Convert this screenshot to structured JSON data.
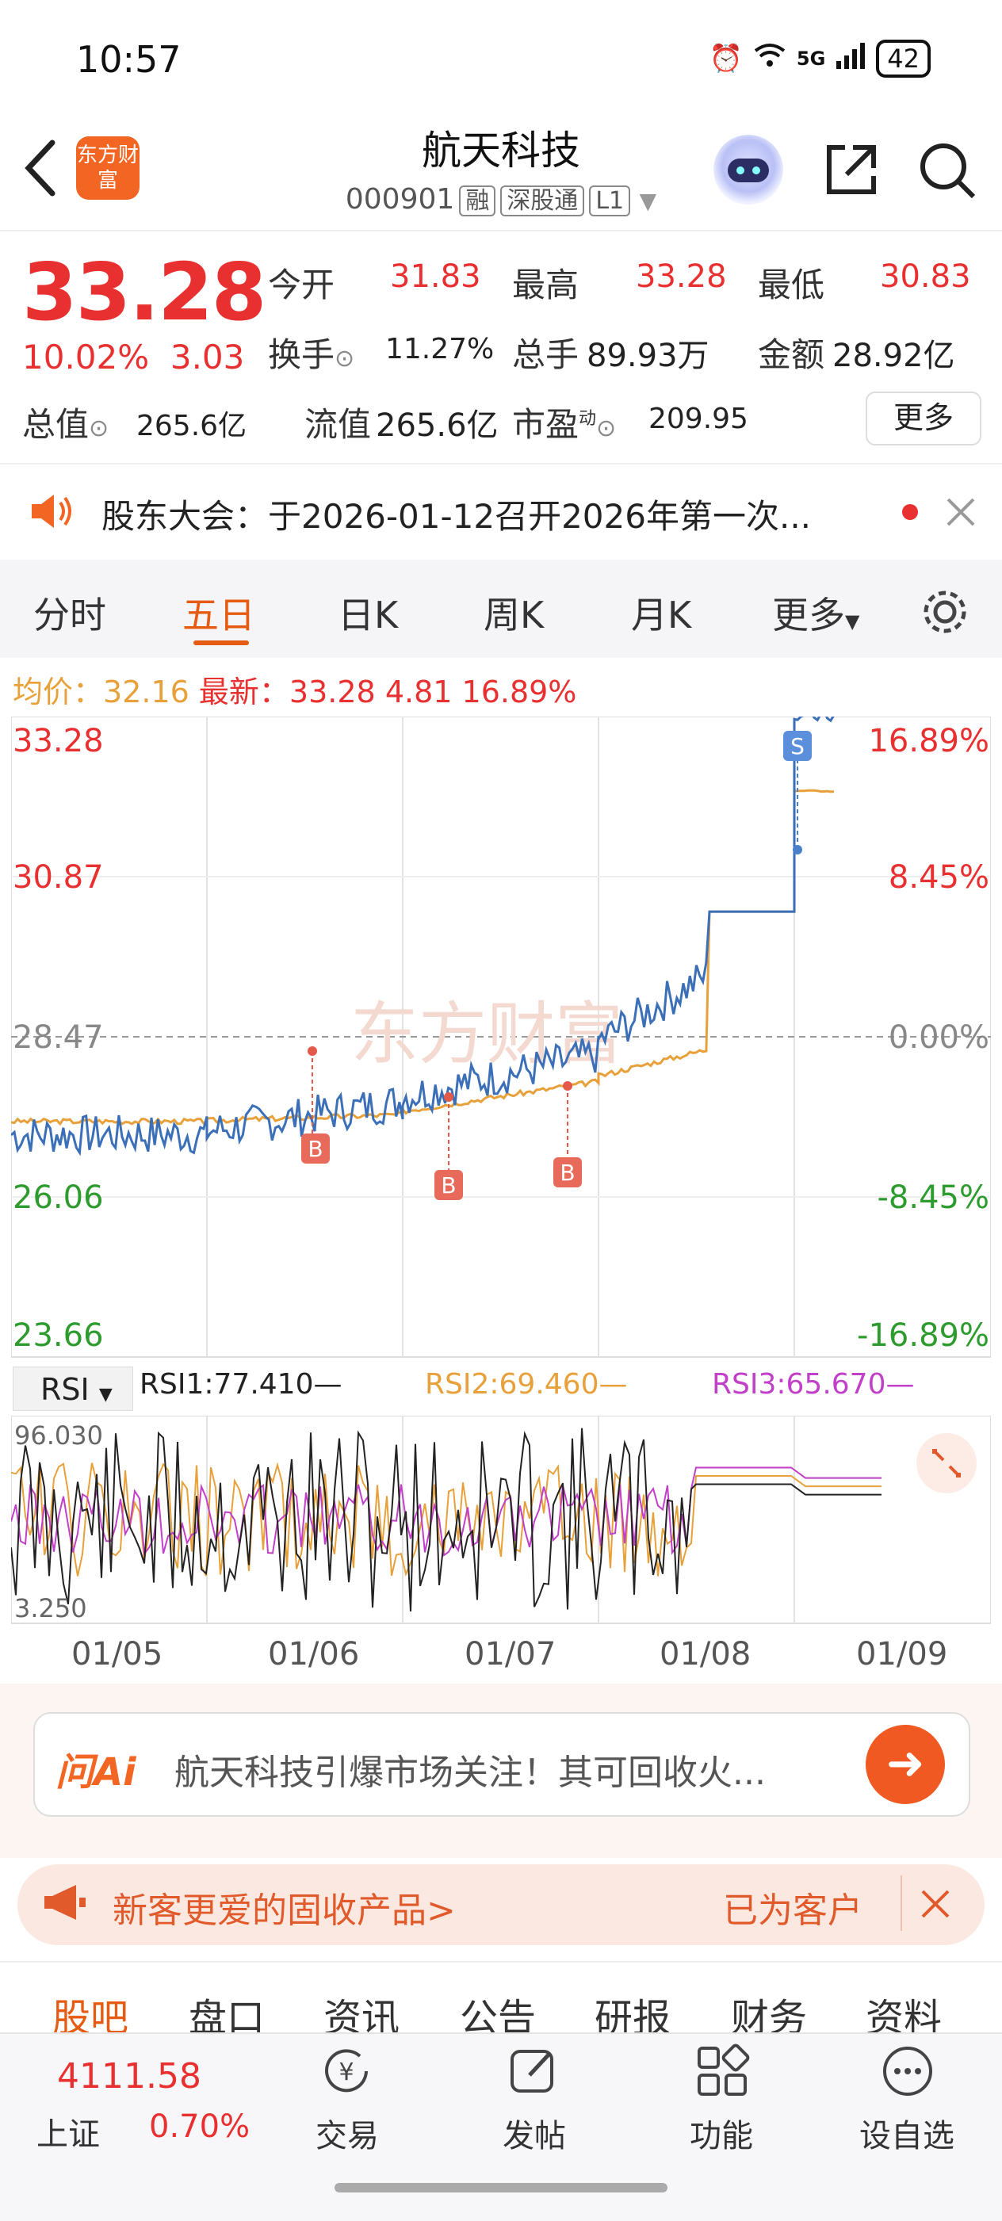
{
  "status": {
    "time": "10:57",
    "network": "5G",
    "battery": "42"
  },
  "header": {
    "logo_text": "东方财富",
    "title": "航天科技",
    "code": "000901",
    "tags": [
      "融",
      "深股通",
      "L1"
    ]
  },
  "quote": {
    "price": "33.28",
    "change_pct": "10.02%",
    "change": "3.03",
    "open_label": "今开",
    "open": "31.83",
    "high_label": "最高",
    "high": "33.28",
    "low_label": "最低",
    "low": "30.83",
    "turnover_label": "换手",
    "turnover": "11.27%",
    "volume_label": "总手",
    "volume": "89.93万",
    "amount_label": "金额",
    "amount": "28.92亿",
    "mktcap_label": "总值",
    "mktcap": "265.6亿",
    "float_label": "流值",
    "float": "265.6亿",
    "pe_label": "市盈",
    "pe_sup": "动",
    "pe": "209.95",
    "more_label": "更多"
  },
  "notice": {
    "text": "股东大会：于2026-01-12召开2026年第一次..."
  },
  "tabs": [
    "分时",
    "五日",
    "日K",
    "周K",
    "月K",
    "更多"
  ],
  "chart": {
    "avg_label": "均价：",
    "avg": "32.16",
    "latest_label": "最新：",
    "latest": "33.28",
    "latest_change": "4.81",
    "latest_pct": "16.89%",
    "y_left": [
      "33.28",
      "30.87",
      "28.47",
      "26.06",
      "23.66"
    ],
    "y_right": [
      "16.89%",
      "8.45%",
      "0.00%",
      "-8.45%",
      "-16.89%"
    ],
    "watermark": "东方财富",
    "markers": [
      "B",
      "B",
      "B",
      "S"
    ],
    "dates": [
      "01/05",
      "01/06",
      "01/07",
      "01/08",
      "01/09"
    ]
  },
  "rsi": {
    "selector": "RSI",
    "rsi1": "RSI1:77.410—",
    "rsi2": "RSI2:69.460—",
    "rsi3": "RSI3:65.670—",
    "top": "96.030",
    "bottom": "3.250"
  },
  "chart_data": {
    "type": "line",
    "x": [
      "01/05",
      "01/06",
      "01/07",
      "01/08",
      "01/09"
    ],
    "series": [
      {
        "values": [
          27.0,
          27.5,
          28.2,
          30.2,
          33.28
        ]
      },
      {
        "values": [
          27.2,
          27.3,
          27.8,
          28.6,
          32.16
        ]
      }
    ],
    "ylim": [
      23.66,
      33.28
    ],
    "colors": {
      "price": "#3b6fb8",
      "avg": "#e8a13a"
    }
  },
  "ai": {
    "logo": "问Ai",
    "text": "航天科技引爆市场关注！其可回收火..."
  },
  "promo": {
    "text": "新客更爱的固收产品>",
    "right": "已为客户"
  },
  "lower_tabs": [
    "股吧",
    "盘口",
    "资讯",
    "公告",
    "研报",
    "财务",
    "资料"
  ],
  "bottom": {
    "index_value": "4111.58",
    "index_name": "上证",
    "index_pct": "0.70%",
    "nav": [
      "交易",
      "发帖",
      "功能",
      "设自选"
    ]
  },
  "colors": {
    "accent": "#e65b12",
    "up": "#e93030",
    "down": "#2e9b2e",
    "price_line": "#3b6fb8",
    "avg_line": "#e8a13a",
    "rsi1": "#222222",
    "rsi2": "#e8a13a",
    "rsi3": "#c23fc9"
  }
}
